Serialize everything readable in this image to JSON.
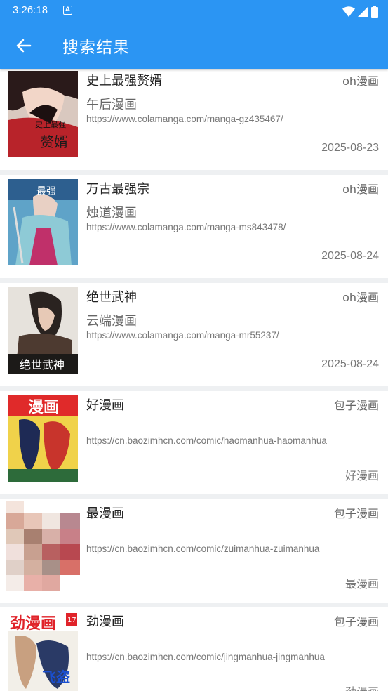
{
  "status_bar": {
    "time": "3:26:18",
    "app_icon_letter": "A"
  },
  "app_bar": {
    "title": "搜索结果"
  },
  "results": [
    {
      "title": "史上最强赘婿",
      "source": "oh漫画",
      "author": "午后漫画",
      "url": "https://www.colamanga.com/manga-gz435467/",
      "date": "2025-08-23"
    },
    {
      "title": "万古最强宗",
      "source": "oh漫画",
      "author": "烛道漫画",
      "url": "https://www.colamanga.com/manga-ms843478/",
      "date": "2025-08-24"
    },
    {
      "title": "绝世武神",
      "source": "oh漫画",
      "author": "云端漫画",
      "url": "https://www.colamanga.com/manga-mr55237/",
      "date": "2025-08-24"
    },
    {
      "title": "好漫画",
      "source": "包子漫画",
      "author": "",
      "url": "https://cn.baozimhcn.com/comic/haomanhua-haomanhua",
      "date": "好漫画"
    },
    {
      "title": "最漫画",
      "source": "包子漫画",
      "author": "",
      "url": "https://cn.baozimhcn.com/comic/zuimanhua-zuimanhua",
      "date": "最漫画"
    },
    {
      "title": "劲漫画",
      "source": "包子漫画",
      "author": "",
      "url": "https://cn.baozimhcn.com/comic/jingmanhua-jingmanhua",
      "date": "劲漫画"
    }
  ],
  "colors": {
    "primary": "#2b95f3",
    "background": "#eef0f2"
  }
}
